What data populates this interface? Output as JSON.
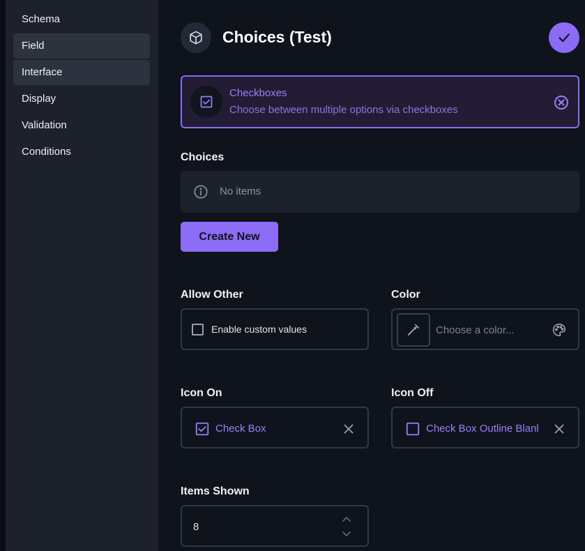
{
  "sidebar": {
    "items": [
      {
        "label": "Schema"
      },
      {
        "label": "Field"
      },
      {
        "label": "Interface"
      },
      {
        "label": "Display"
      },
      {
        "label": "Validation"
      },
      {
        "label": "Conditions"
      }
    ]
  },
  "header": {
    "title": "Choices (Test)",
    "icon": "cube-icon",
    "save_icon": "check-icon"
  },
  "interface": {
    "name": "Checkboxes",
    "description": "Choose between multiple options via checkboxes",
    "icon": "checkbox-checked-icon"
  },
  "choices": {
    "label": "Choices",
    "empty_text": "No items",
    "create_label": "Create New"
  },
  "allow_other": {
    "label": "Allow Other",
    "checkbox_label": "Enable custom values",
    "checked": false
  },
  "color": {
    "label": "Color",
    "placeholder": "Choose a color..."
  },
  "icon_on": {
    "label": "Icon On",
    "value": "Check Box"
  },
  "icon_off": {
    "label": "Icon Off",
    "value": "Check Box Outline Blanl"
  },
  "items_shown": {
    "label": "Items Shown",
    "value": "8"
  },
  "colors": {
    "accent": "#8c6cf5",
    "sidebar_bg": "#1c212c",
    "page_bg": "#0f131c"
  }
}
